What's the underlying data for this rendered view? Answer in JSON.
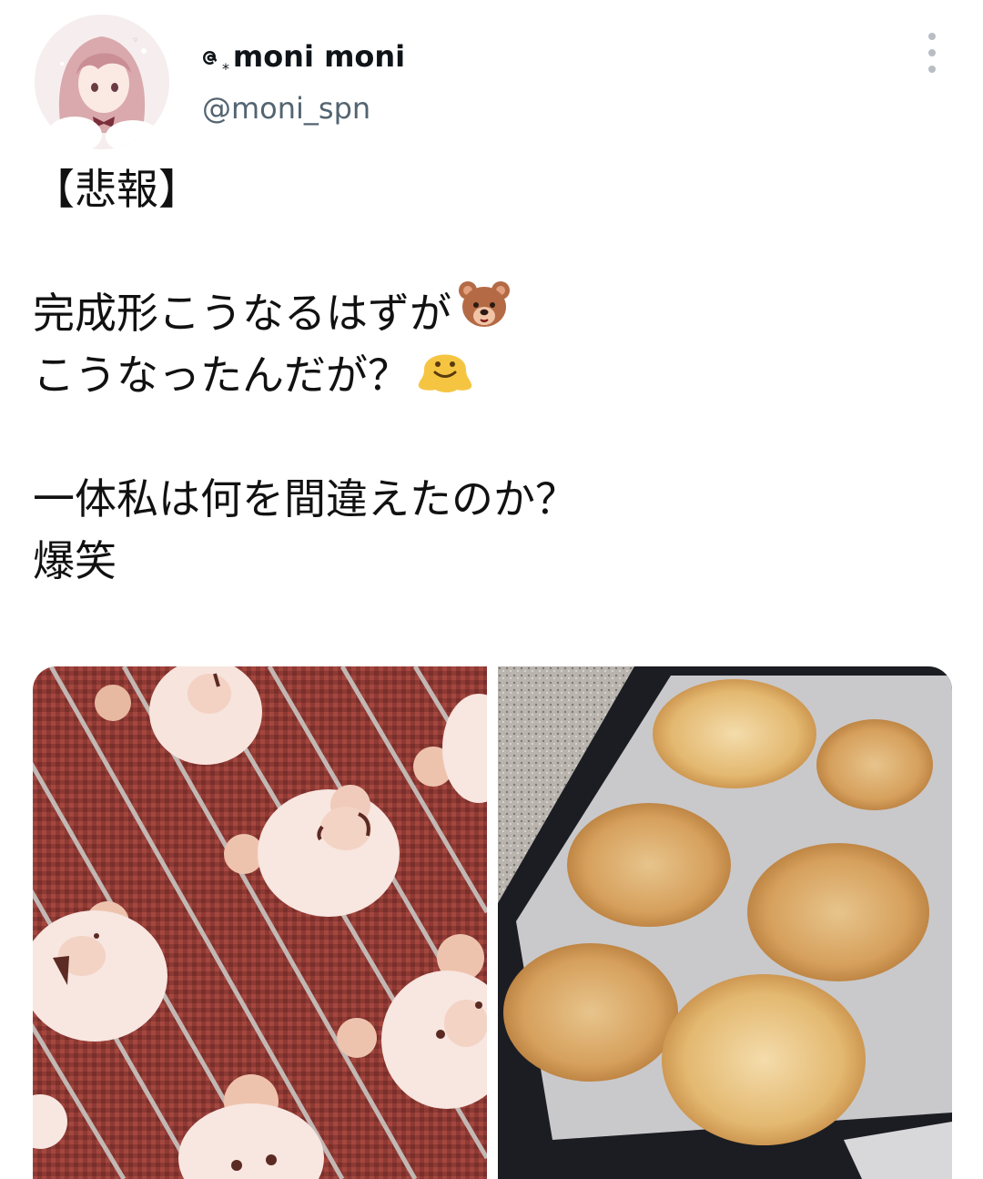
{
  "tweet": {
    "author": {
      "display_name": "moni moni",
      "name_prefix_glyph": "ဇ",
      "name_prefix_star": "*",
      "handle": "@moni_spn"
    },
    "text_lines": [
      "【悲報】",
      "",
      "完成形こうなるはずが",
      "こうなったんだが？",
      "",
      "一体私は何を間違えたのか？",
      "爆笑"
    ],
    "emojis": {
      "line_3": "bear-face-emoji",
      "line_4": "melting-face-emoji"
    },
    "media": [
      {
        "name": "bear-cookies-on-rack-photo"
      },
      {
        "name": "spread-cookies-on-tray-photo"
      }
    ],
    "icons": {
      "more": "more-vertical-icon"
    },
    "colors": {
      "text": "#0f1419",
      "secondary_text": "#536471",
      "more_dots": "#b7bec4"
    }
  }
}
